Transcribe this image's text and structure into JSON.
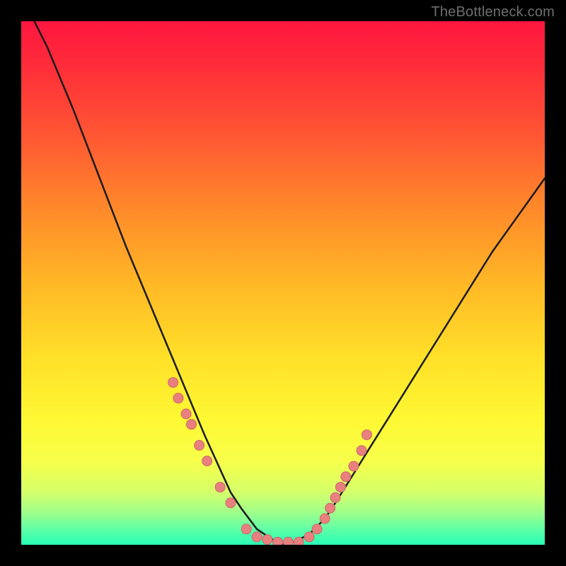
{
  "watermark": "TheBottleneck.com",
  "colors": {
    "frame": "#000000",
    "curve_stroke": "#1a1a1a",
    "dot_fill": "#e98080",
    "dot_stroke": "#cc6666",
    "gradient_top": "#ff163f",
    "gradient_bottom": "#28ffb5"
  },
  "chart_data": {
    "type": "line",
    "title": "",
    "xlabel": "",
    "ylabel": "",
    "xlim": [
      0,
      100
    ],
    "ylim": [
      0,
      100
    ],
    "series": [
      {
        "name": "bottleneck-curve",
        "x": [
          0,
          5,
          10,
          15,
          20,
          25,
          30,
          35,
          40,
          42,
          45,
          48,
          50,
          52,
          55,
          58,
          60,
          65,
          70,
          75,
          80,
          85,
          90,
          95,
          100
        ],
        "values": [
          105,
          95,
          83,
          70,
          57,
          45,
          33,
          21,
          10,
          7,
          3,
          1,
          0,
          0.5,
          2,
          5,
          8,
          16,
          24,
          32,
          40,
          48,
          56,
          63,
          70
        ]
      }
    ],
    "scatter_points": {
      "name": "sample-dots",
      "x": [
        29,
        30,
        31.5,
        32.5,
        34,
        35.5,
        38,
        40,
        43,
        45,
        47,
        49,
        51,
        53,
        55,
        56.5,
        58,
        59,
        60,
        61,
        62,
        63.5,
        65,
        66
      ],
      "y": [
        31,
        28,
        25,
        23,
        19,
        16,
        11,
        8,
        3,
        1.5,
        1,
        0.5,
        0.5,
        0.5,
        1.5,
        3,
        5,
        7,
        9,
        11,
        13,
        15,
        18,
        21
      ]
    },
    "note": "Values are read from pixel positions; x and y are in 0–100 relative plot-area units, y=0 is bottom (green), y=100 is top (red)."
  }
}
